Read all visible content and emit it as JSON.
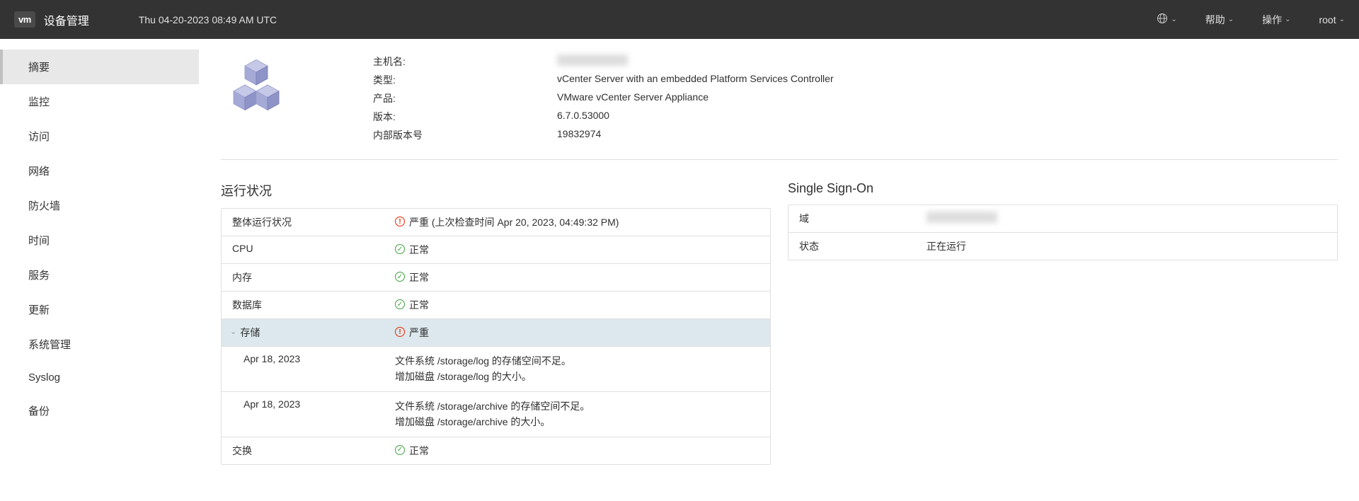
{
  "header": {
    "logo": "vm",
    "title": "设备管理",
    "datetime": "Thu 04-20-2023 08:49 AM UTC",
    "help": "帮助",
    "actions": "操作",
    "user": "root"
  },
  "sidebar": {
    "items": [
      {
        "label": "摘要",
        "active": true
      },
      {
        "label": "监控",
        "active": false
      },
      {
        "label": "访问",
        "active": false
      },
      {
        "label": "网络",
        "active": false
      },
      {
        "label": "防火墙",
        "active": false
      },
      {
        "label": "时间",
        "active": false
      },
      {
        "label": "服务",
        "active": false
      },
      {
        "label": "更新",
        "active": false
      },
      {
        "label": "系统管理",
        "active": false
      },
      {
        "label": "Syslog",
        "active": false
      },
      {
        "label": "备份",
        "active": false
      }
    ]
  },
  "summary": {
    "fields": {
      "hostname_label": "主机名:",
      "hostname_value": "████████",
      "type_label": "类型:",
      "type_value": "vCenter Server with an embedded Platform Services Controller",
      "product_label": "产品:",
      "product_value": "VMware vCenter Server Appliance",
      "version_label": "版本:",
      "version_value": "6.7.0.53000",
      "build_label": "内部版本号",
      "build_value": "19832974"
    }
  },
  "health": {
    "title": "运行状况",
    "rows": {
      "overall_label": "整体运行状况",
      "overall_status": "严重",
      "overall_suffix": " (上次检查时间 Apr 20, 2023, 04:49:32 PM)",
      "cpu_label": "CPU",
      "cpu_status": "正常",
      "mem_label": "内存",
      "mem_status": "正常",
      "db_label": "数据库",
      "db_status": "正常",
      "storage_label": "存储",
      "storage_status": "严重",
      "sub1_date": "Apr 18, 2023",
      "sub1_line1": "文件系统 /storage/log 的存储空间不足。",
      "sub1_line2": "增加磁盘 /storage/log 的大小。",
      "sub2_date": "Apr 18, 2023",
      "sub2_line1": "文件系统 /storage/archive 的存储空间不足。",
      "sub2_line2": "增加磁盘 /storage/archive 的大小。",
      "swap_label": "交换",
      "swap_status": "正常"
    }
  },
  "sso": {
    "title": "Single Sign-On",
    "domain_label": "域",
    "domain_value": "████████",
    "status_label": "状态",
    "status_value": "正在运行"
  }
}
